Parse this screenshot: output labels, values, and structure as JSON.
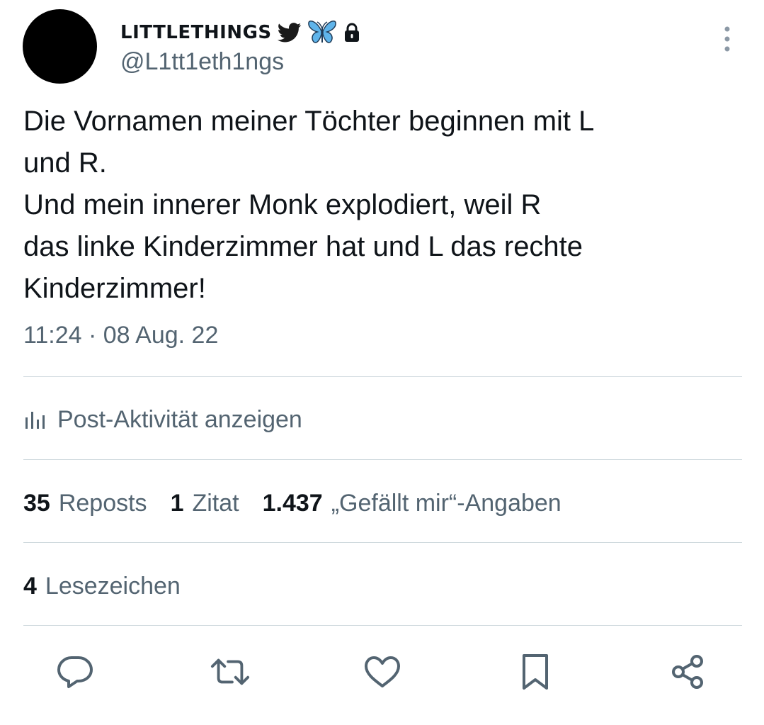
{
  "author": {
    "display_name": "LITTLETHINGS",
    "handle": "@L1tt1eth1ngs",
    "badges": [
      "bird-icon",
      "butterfly-icon",
      "lock-icon"
    ]
  },
  "tweet": {
    "lines": [
      "Die Vornamen meiner Töchter beginnen mit L",
      "und R.",
      "Und mein innerer Monk explodiert, weil R",
      "das linke Kinderzimmer hat und L das rechte",
      "Kinderzimmer!"
    ],
    "timestamp": "11:24 · 08 Aug. 22"
  },
  "activity": {
    "label": "Post-Aktivität anzeigen",
    "icon": "analytics-icon"
  },
  "stats": {
    "reposts_count": "35",
    "reposts_label": "Reposts",
    "quotes_count": "1",
    "quotes_label": "Zitat",
    "likes_count": "1.437",
    "likes_label": "„Gefällt mir“-Angaben",
    "bookmarks_count": "4",
    "bookmarks_label": "Lesezeichen"
  },
  "actions": [
    "reply-icon",
    "repost-icon",
    "like-icon",
    "bookmark-icon",
    "share-icon"
  ],
  "colors": {
    "text_primary": "#0f1419",
    "text_secondary": "#536471",
    "divider": "#cfd9de",
    "bird_blue": "#1d9bf0",
    "butterfly_blue": "#4aa3e0"
  }
}
